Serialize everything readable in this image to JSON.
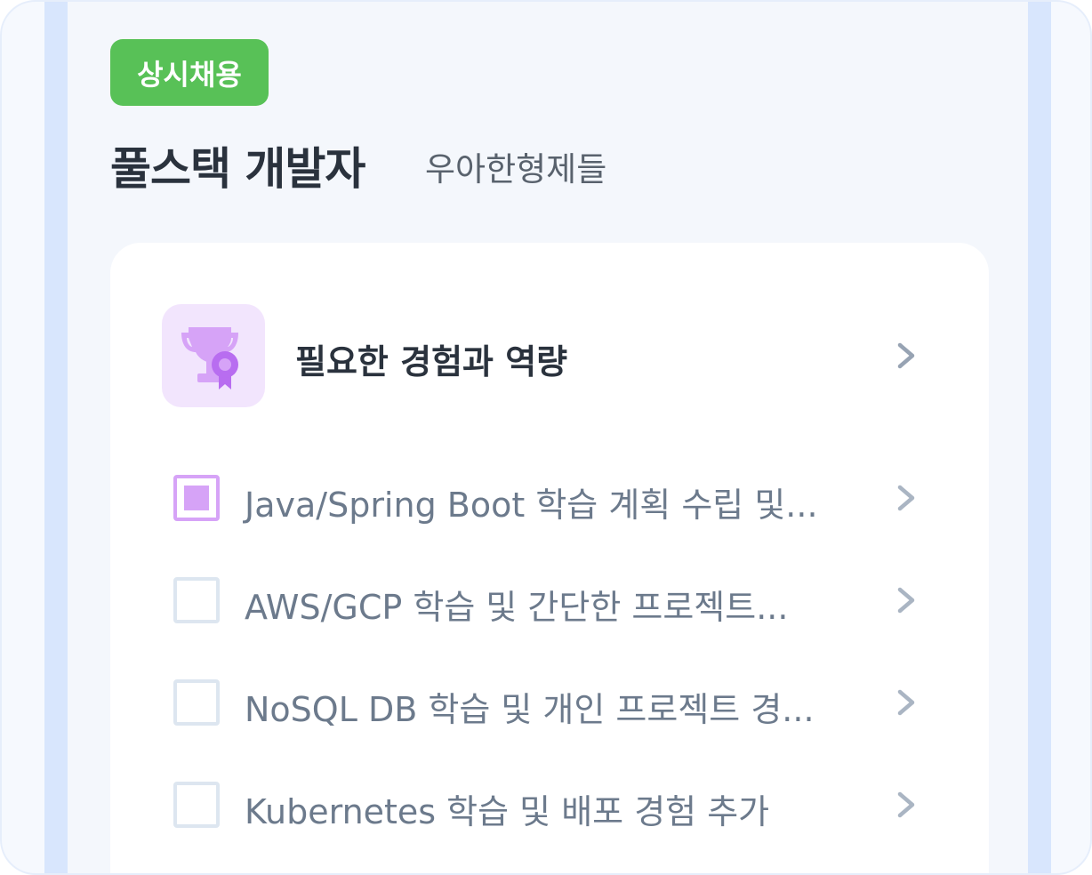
{
  "job": {
    "badge": "상시채용",
    "title": "풀스택 개발자",
    "company": "우아한형제들"
  },
  "section": {
    "icon": "trophy-award-icon",
    "title": "필요한 경험과 역량"
  },
  "items": [
    {
      "label": "Java/Spring Boot 학습 계획 수립 및...",
      "checked": true
    },
    {
      "label": "AWS/GCP 학습 및 간단한 프로젝트...",
      "checked": false
    },
    {
      "label": "NoSQL DB 학습 및 개인 프로젝트 경...",
      "checked": false
    },
    {
      "label": "Kubernetes 학습 및 배포 경험 추가",
      "checked": false
    }
  ],
  "colors": {
    "badge": "#58c157",
    "accent_purple": "#d6a3f7",
    "text_dark": "#2a323d",
    "text_muted": "#6c7a8c"
  }
}
